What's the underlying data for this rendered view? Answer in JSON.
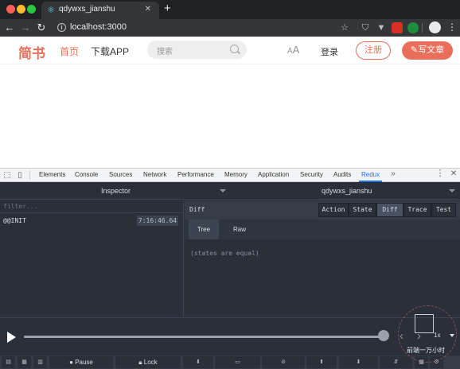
{
  "browser": {
    "tab_title": "qdywxs_jianshu",
    "tab_close": "✕",
    "new_tab": "+",
    "url": "localhost:3000",
    "back": "←",
    "forward": "→",
    "reload": "↻",
    "info": "i",
    "star": "☆",
    "ext1": "⛉",
    "ext2": "▼",
    "ext3": "⬛",
    "ext4": "●",
    "profile": "●",
    "menu": "⋮"
  },
  "site": {
    "logo": "简书",
    "nav_home": "首页",
    "nav_app": "下载APP",
    "search_placeholder": "搜索",
    "font_toggle_big": "A",
    "font_toggle_small": "A",
    "login": "登录",
    "signup": "注册",
    "write": "✎写文章",
    "colors": {
      "accent": "#ea6f5a"
    }
  },
  "devtools": {
    "tabs": [
      "Elements",
      "Console",
      "Sources",
      "Network",
      "Performance",
      "Memory",
      "Application",
      "Security",
      "Audits",
      "Redux"
    ],
    "active_tab": "Redux",
    "more": "»",
    "menu": "⋮",
    "close": "✕"
  },
  "redux": {
    "inspector": "Inspector",
    "instance": "qdywxs_jianshu",
    "filter_placeholder": "filter...",
    "actions": [
      {
        "name": "@@INIT",
        "time": "7:16:46.64"
      }
    ],
    "panel_title": "Diff",
    "modes": [
      "Action",
      "State",
      "Diff",
      "Trace",
      "Test"
    ],
    "active_mode": "Diff",
    "subtabs": [
      "Tree",
      "Raw"
    ],
    "active_subtab": "Tree",
    "diff_message": "(states are equal)",
    "slider_progress": 1.0,
    "speed": "1x",
    "step_back": "‹",
    "step_forward": "›",
    "bottom": {
      "pause": "Pause",
      "lock": "Lock"
    },
    "watermark": "前端一万小时"
  }
}
